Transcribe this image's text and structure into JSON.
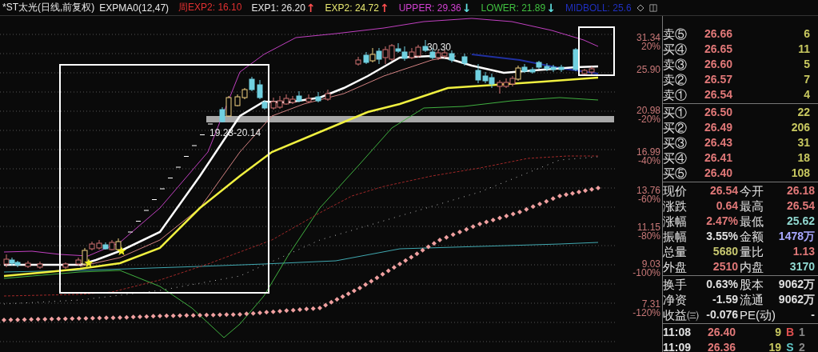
{
  "header": {
    "title": "*ST太光(日线,前复权)",
    "indicator": "EXPMA0(12,47)",
    "legend": [
      {
        "label": "周EXP2: 16.10",
        "color": "#e03030"
      },
      {
        "label": "EXP1: 26.20",
        "color": "#e8e8e8",
        "arrow": {
          "text": "↑",
          "color": "#ff5050"
        }
      },
      {
        "label": "EXP2: 24.72",
        "color": "#e8e870",
        "arrow": {
          "text": "↑",
          "color": "#ff5050"
        }
      },
      {
        "label": "UPPER: 29.36",
        "color": "#d040d0",
        "arrow": {
          "text": "↓",
          "color": "#60e0e0"
        }
      },
      {
        "label": "LOWER: 21.89",
        "color": "#40c040",
        "arrow": {
          "text": "↓",
          "color": "#60e0e0"
        }
      },
      {
        "label": "MIDBOLL: 25.6",
        "color": "#2030c0"
      }
    ]
  },
  "chart": {
    "labels": [
      {
        "text": "19.23-20.14",
        "kind": "range"
      },
      {
        "text": "30.30",
        "kind": "peak"
      }
    ],
    "axis": [
      {
        "price": "31.34",
        "percent": "20%"
      },
      {
        "price": "25.90"
      },
      {
        "price": "20.98",
        "percent": "-20%"
      },
      {
        "price": "16.99",
        "percent": "-40%"
      },
      {
        "price": "13.76",
        "percent": "-60%"
      },
      {
        "price": "11.15",
        "percent": "-80%"
      },
      {
        "price": "9.03",
        "percent": "-100%"
      },
      {
        "price": "7.31",
        "percent": "-120%"
      }
    ]
  },
  "orderbook": {
    "asks": [
      {
        "label": "卖⑤",
        "price": "26.66",
        "volume": "6"
      },
      {
        "label": "买④",
        "price": "26.65",
        "volume": "11"
      },
      {
        "label": "卖③",
        "price": "26.60",
        "volume": "5"
      },
      {
        "label": "卖②",
        "price": "26.57",
        "volume": "7"
      },
      {
        "label": "卖①",
        "price": "26.54",
        "volume": "4"
      }
    ],
    "bids": [
      {
        "label": "买①",
        "price": "26.50",
        "volume": "22"
      },
      {
        "label": "买②",
        "price": "26.49",
        "volume": "206"
      },
      {
        "label": "买③",
        "price": "26.43",
        "volume": "31"
      },
      {
        "label": "买④",
        "price": "26.41",
        "volume": "18"
      },
      {
        "label": "买⑤",
        "price": "26.40",
        "volume": "108"
      }
    ]
  },
  "quote": [
    {
      "label": "现价",
      "value": "26.54",
      "color": "#e07878"
    },
    {
      "label": "今开",
      "value": "26.18",
      "color": "#e07878"
    },
    {
      "label": "涨跌",
      "value": "0.64",
      "color": "#e07878"
    },
    {
      "label": "最高",
      "value": "26.54",
      "color": "#e07878"
    },
    {
      "label": "涨幅",
      "value": "2.47%",
      "color": "#e07878"
    },
    {
      "label": "最低",
      "value": "25.62",
      "color": "#90d8d0"
    },
    {
      "label": "振幅",
      "value": "3.55%",
      "color": "#e0e0e0"
    },
    {
      "label": "金额",
      "value": "1478万",
      "color": "#a8a8ff"
    },
    {
      "label": "总量",
      "value": "5680",
      "color": "#c8c870"
    },
    {
      "label": "量比",
      "value": "1.13",
      "color": "#e07878"
    },
    {
      "label": "外盘",
      "value": "2510",
      "color": "#e07878"
    },
    {
      "label": "内盘",
      "value": "3170",
      "color": "#90d8d0"
    }
  ],
  "fundamentals": [
    {
      "label": "换手",
      "value": "0.63%",
      "color": "#e0e0e0"
    },
    {
      "label": "股本",
      "value": "9062万",
      "color": "#e0e0e0"
    },
    {
      "label": "净资",
      "value": "-1.59",
      "color": "#e0e0e0"
    },
    {
      "label": "流通",
      "value": "9062万",
      "color": "#e0e0e0"
    },
    {
      "label": "收益㈢",
      "value": "-0.076",
      "color": "#e0e0e0"
    },
    {
      "label": "PE(动)",
      "value": "-",
      "color": "#e0e0e0"
    }
  ],
  "ticks": [
    {
      "time": "11:08",
      "price": "26.40",
      "volume": "9",
      "side": {
        "text": "B",
        "color": "#e05050"
      },
      "count": "1"
    },
    {
      "time": "11:09",
      "price": "26.36",
      "volume": "19",
      "side": {
        "text": "S",
        "color": "#60c8c8"
      },
      "count": "2"
    }
  ]
}
